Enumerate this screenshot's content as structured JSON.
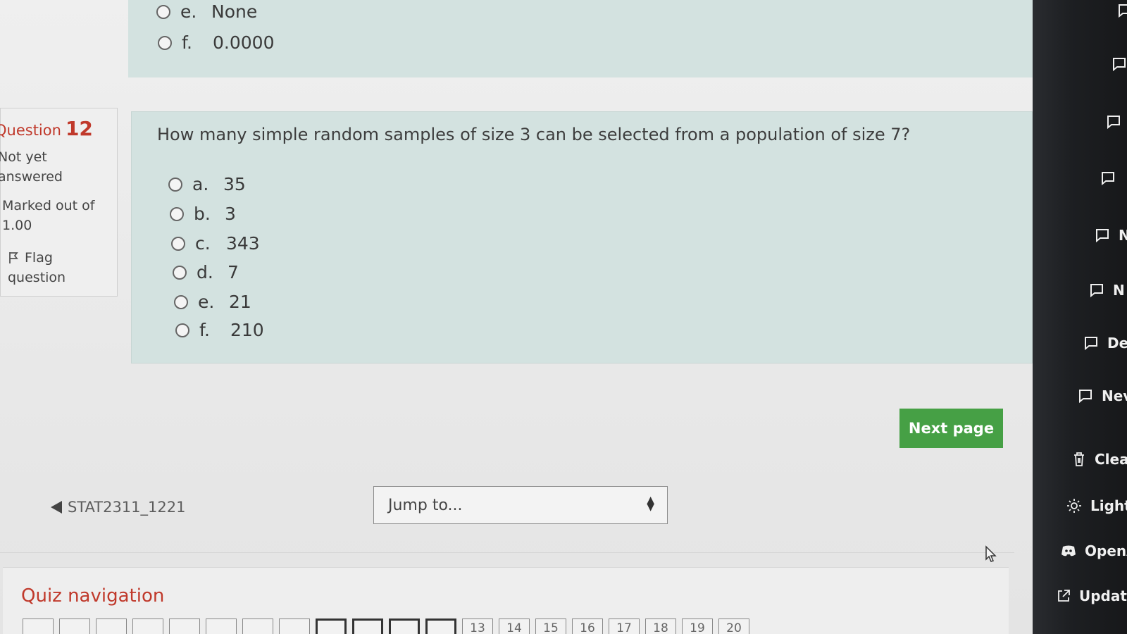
{
  "prev_question": {
    "options": [
      {
        "letter": "e.",
        "text": "None"
      },
      {
        "letter": "f.",
        "text": "0.0000"
      }
    ]
  },
  "info": {
    "question_word": "Question",
    "question_number": "12",
    "status_line1": "Not yet",
    "status_line2": "answered",
    "marked_line1": "Marked out of",
    "marked_line2": "1.00",
    "flag_line1": "Flag",
    "flag_line2": "question"
  },
  "question": {
    "text": "How many simple random samples of size 3 can be selected from a population of size 7?",
    "options": [
      {
        "letter": "a.",
        "text": "35"
      },
      {
        "letter": "b.",
        "text": "3"
      },
      {
        "letter": "c.",
        "text": "343"
      },
      {
        "letter": "d.",
        "text": "7"
      },
      {
        "letter": "e.",
        "text": "21"
      },
      {
        "letter": "f.",
        "text": "210"
      }
    ]
  },
  "next_button": "Next page",
  "prev_link": "STAT2311_1221",
  "jump": {
    "placeholder": "Jump to..."
  },
  "quiz_nav": {
    "title": "Quiz navigation",
    "numbers": [
      "13",
      "14",
      "15",
      "16",
      "17",
      "18",
      "19",
      "20"
    ]
  },
  "right_panel": {
    "items": [
      "",
      "",
      "",
      "",
      "N",
      "N",
      "De",
      "Nev",
      "Clear",
      "Light",
      "OpenA",
      "Update"
    ]
  },
  "colors": {
    "accent_red": "#c0392b",
    "button_green": "#46a045",
    "panel_teal": "#d3e2e0"
  }
}
